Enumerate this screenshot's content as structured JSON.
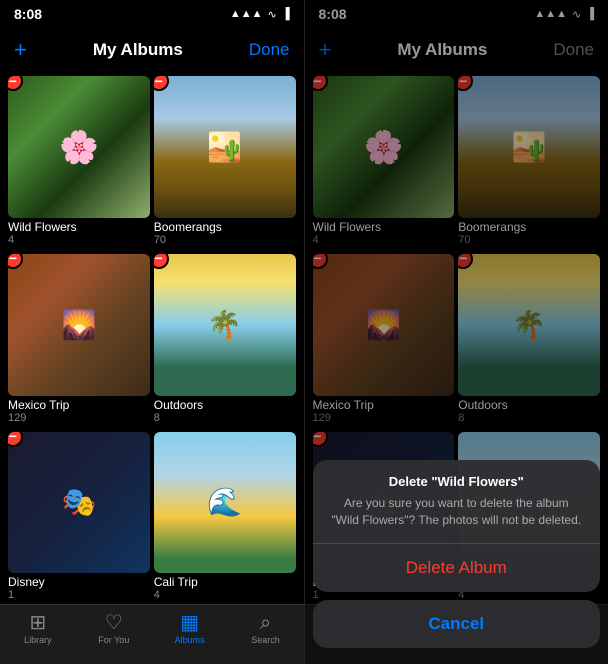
{
  "left_panel": {
    "status": {
      "time": "8:08",
      "signal_icon": "▲▲▲",
      "wifi_icon": "WiFi",
      "battery_icon": "🔋"
    },
    "nav": {
      "add_label": "+",
      "title": "My Albums",
      "done_label": "Done",
      "done_state": "active"
    },
    "albums": [
      {
        "name": "Wild Flowers",
        "count": "4",
        "thumb": "wild-flowers",
        "has_delete": true
      },
      {
        "name": "Boomerangs",
        "count": "70",
        "thumb": "boomerangs",
        "has_delete": true
      },
      {
        "name": "Mexico Trip",
        "count": "129",
        "thumb": "mexico",
        "has_delete": true
      },
      {
        "name": "Outdoors",
        "count": "8",
        "thumb": "outdoors",
        "has_delete": true
      },
      {
        "name": "Disney",
        "count": "1",
        "thumb": "disney",
        "has_delete": true
      },
      {
        "name": "Cali Trip",
        "count": "4",
        "thumb": "cali",
        "has_delete": false
      }
    ],
    "tabs": [
      {
        "label": "Library",
        "icon": "⊞",
        "active": false
      },
      {
        "label": "For You",
        "icon": "♡",
        "active": false
      },
      {
        "label": "Albums",
        "icon": "▦",
        "active": true
      },
      {
        "label": "Search",
        "icon": "⌕",
        "active": false
      }
    ]
  },
  "right_panel": {
    "status": {
      "time": "8:08"
    },
    "nav": {
      "title": "My Albums",
      "done_label": "Done",
      "done_state": "inactive"
    },
    "albums": [
      {
        "name": "Wild Flowers",
        "count": "4",
        "thumb": "wild-flowers",
        "has_delete": true
      },
      {
        "name": "Boomerangs",
        "count": "70",
        "thumb": "boomerangs",
        "has_delete": true
      },
      {
        "name": "Mexico Trip",
        "count": "129",
        "thumb": "mexico",
        "has_delete": true
      },
      {
        "name": "Outdoors",
        "count": "8",
        "thumb": "outdoors",
        "has_delete": true
      },
      {
        "name": "Disney",
        "count": "1",
        "thumb": "disney",
        "has_delete": true
      },
      {
        "name": "Cali Trip",
        "count": "4",
        "thumb": "cali",
        "has_delete": false
      }
    ],
    "dialog": {
      "title": "Delete \"Wild Flowers\"",
      "message": "Are you sure you want to delete the album \"Wild Flowers\"? The photos will not be deleted.",
      "delete_label": "Delete Album",
      "cancel_label": "Cancel"
    },
    "tabs": [
      {
        "label": "Library",
        "icon": "⊞",
        "active": false
      },
      {
        "label": "For You",
        "icon": "♡",
        "active": false
      },
      {
        "label": "Albums",
        "icon": "▦",
        "active": true
      },
      {
        "label": "Search",
        "icon": "⌕",
        "active": false
      }
    ]
  }
}
